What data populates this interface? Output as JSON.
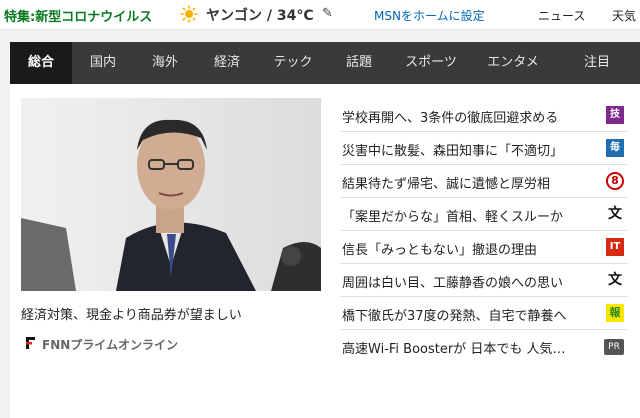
{
  "topbar": {
    "special": "特集:新型コロナウイルス",
    "weather": "ヤンゴン / 34°C",
    "msn_home": "MSNをホームに設定",
    "news": "ニュース",
    "weather_link": "天気"
  },
  "tabs": [
    {
      "label": "総合",
      "active": true
    },
    {
      "label": "国内",
      "active": false
    },
    {
      "label": "海外",
      "active": false
    },
    {
      "label": "経済",
      "active": false
    },
    {
      "label": "テック",
      "active": false
    },
    {
      "label": "話題",
      "active": false
    },
    {
      "label": "スポーツ",
      "active": false
    },
    {
      "label": "エンタメ",
      "active": false
    },
    {
      "label": "注目",
      "active": false
    }
  ],
  "hero": {
    "headline": "経済対策、現金より商品券が望ましい",
    "source": "FNNプライムオンライン",
    "source_logo_letter": "F"
  },
  "articles": [
    {
      "text": "学校再開へ、3条件の徹底回避求める",
      "logo": "技",
      "logo_color": "#7b2a8c"
    },
    {
      "text": "災害中に散髪、森田知事に「不適切」",
      "logo": "毎",
      "logo_color": "#1f6fb2"
    },
    {
      "text": "結果待たず帰宅、誠に遺憾と厚労相",
      "logo": "8",
      "logo_color": "#cc0000"
    },
    {
      "text": "「案里だからな」首相、軽くスルーか",
      "logo": "文",
      "logo_color": "#111111"
    },
    {
      "text": "信長「みっともない」撤退の理由",
      "logo": "IT",
      "logo_color": "#d62a12"
    },
    {
      "text": "周囲は白い目、工藤静香の娘への思い",
      "logo": "文",
      "logo_color": "#111111"
    },
    {
      "text": "橋下徹氏が37度の発熱、自宅で静養へ",
      "logo": "報",
      "logo_color": "#2a8c1f"
    },
    {
      "text": "高速Wi-Fi Boosterが 日本でも 人気…",
      "logo": "PR",
      "logo_color": "#555555"
    }
  ]
}
